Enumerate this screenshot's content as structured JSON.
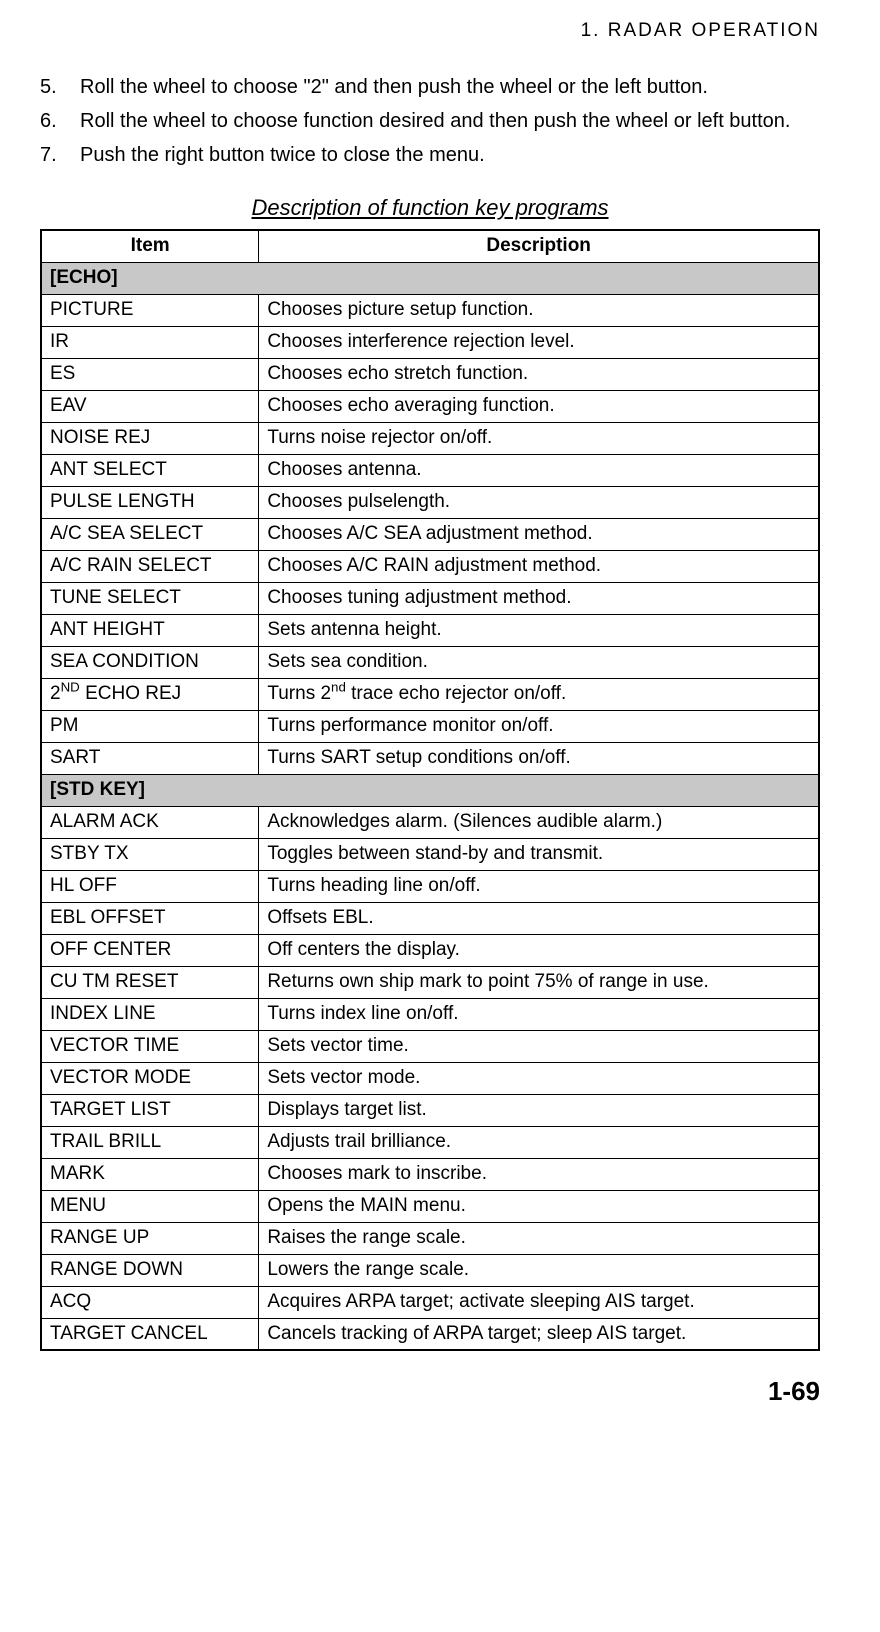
{
  "header": "1.  RADAR  OPERATION",
  "steps": [
    "Roll the wheel to choose \"2\" and then push the wheel or the left button.",
    "Roll the wheel to choose function desired and then push the wheel or left button.",
    "Push the right button twice to close the menu."
  ],
  "table_title": "Description of function key programs",
  "columns": {
    "item": "Item",
    "desc": "Description"
  },
  "sections": [
    {
      "label": "[ECHO]",
      "rows": [
        {
          "item": "PICTURE",
          "desc": "Chooses picture setup function."
        },
        {
          "item": "IR",
          "desc": "Chooses interference rejection level."
        },
        {
          "item": "ES",
          "desc": "Chooses echo stretch function."
        },
        {
          "item": "EAV",
          "desc": "Chooses echo averaging function."
        },
        {
          "item": "NOISE REJ",
          "desc": "Turns noise rejector on/off."
        },
        {
          "item": "ANT SELECT",
          "desc": "Chooses antenna."
        },
        {
          "item": "PULSE LENGTH",
          "desc": "Chooses pulselength."
        },
        {
          "item": "A/C SEA SELECT",
          "desc": "Chooses A/C SEA adjustment method."
        },
        {
          "item": "A/C RAIN SELECT",
          "desc": "Chooses A/C RAIN adjustment method."
        },
        {
          "item": "TUNE SELECT",
          "desc": "Chooses tuning adjustment method."
        },
        {
          "item": "ANT HEIGHT",
          "desc": "Sets antenna height."
        },
        {
          "item": "SEA CONDITION",
          "desc": "Sets sea condition."
        },
        {
          "item_html": "2<sup>ND</sup> ECHO REJ",
          "desc_html": "Turns 2<sup>nd</sup> trace echo rejector on/off."
        },
        {
          "item": "PM",
          "desc": "Turns performance monitor on/off."
        },
        {
          "item": "SART",
          "desc": "Turns SART setup conditions on/off."
        }
      ]
    },
    {
      "label": "[STD KEY]",
      "rows": [
        {
          "item": "ALARM ACK",
          "desc": "Acknowledges alarm. (Silences audible alarm.)"
        },
        {
          "item": "STBY TX",
          "desc": "Toggles between stand-by and transmit."
        },
        {
          "item": "HL OFF",
          "desc": "Turns heading line on/off."
        },
        {
          "item": "EBL OFFSET",
          "desc": "Offsets EBL."
        },
        {
          "item": "OFF CENTER",
          "desc": "Off centers the display."
        },
        {
          "item": "CU TM RESET",
          "desc": "Returns own ship mark to point 75% of range in use."
        },
        {
          "item": "INDEX LINE",
          "desc": "Turns index line on/off."
        },
        {
          "item": "VECTOR TIME",
          "desc": "Sets vector time."
        },
        {
          "item": "VECTOR MODE",
          "desc": "Sets vector mode."
        },
        {
          "item": "TARGET LIST",
          "desc": "Displays target list."
        },
        {
          "item": "TRAIL BRILL",
          "desc": "Adjusts trail brilliance."
        },
        {
          "item": "MARK",
          "desc": "Chooses mark to inscribe."
        },
        {
          "item": "MENU",
          "desc": "Opens the MAIN menu."
        },
        {
          "item": "RANGE UP",
          "desc": "Raises the range scale."
        },
        {
          "item": "RANGE DOWN",
          "desc": "Lowers the range scale."
        },
        {
          "item": "ACQ",
          "desc": "Acquires ARPA target; activate sleeping AIS target."
        },
        {
          "item": "TARGET CANCEL",
          "desc": "Cancels tracking of ARPA target; sleep AIS target."
        }
      ]
    }
  ],
  "page_number": "1-69"
}
